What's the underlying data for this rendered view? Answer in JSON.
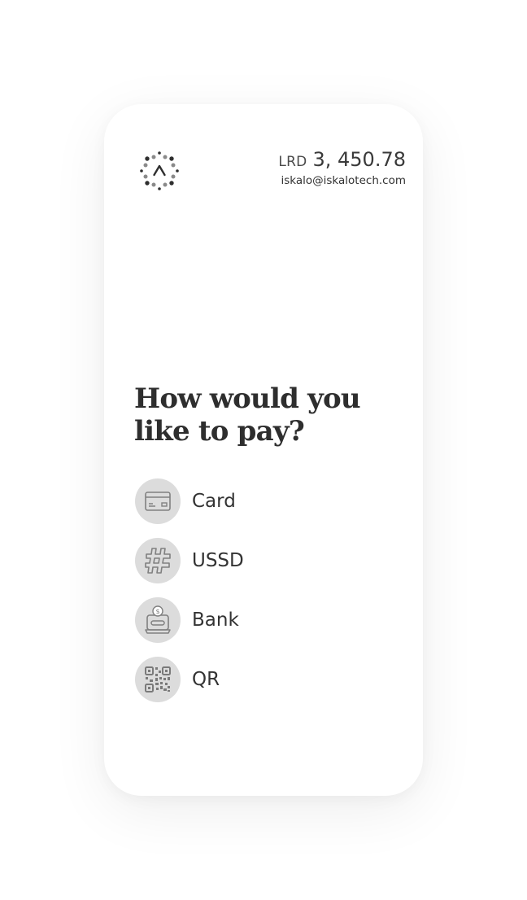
{
  "header": {
    "logo_icon": "dotted-ring-caret-logo",
    "currency": "LRD",
    "amount": "3, 450.78",
    "email": "iskalo@iskalotech.com"
  },
  "main": {
    "heading_line1": "How would you",
    "heading_line2": "like to pay?",
    "payment_options": [
      {
        "label": "Card",
        "icon": "credit-card-icon"
      },
      {
        "label": "USSD",
        "icon": "hash-icon"
      },
      {
        "label": "Bank",
        "icon": "bank-transfer-icon"
      },
      {
        "label": "QR",
        "icon": "qr-code-icon"
      }
    ]
  },
  "colors": {
    "icon_circle": "#dcdcdc",
    "icon_stroke": "#808080",
    "text": "#333333"
  }
}
